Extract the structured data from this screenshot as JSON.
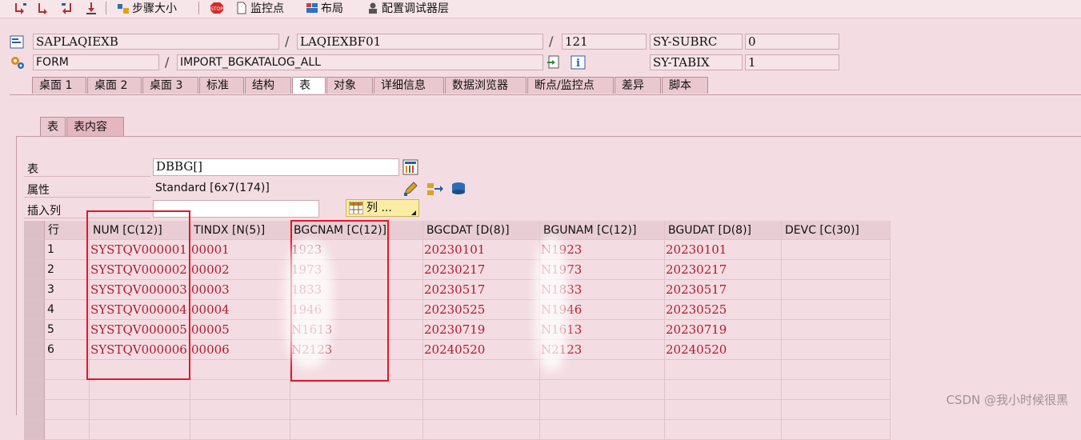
{
  "toolbar": {
    "step_size": "步骤大小",
    "watchpoint": "监控点",
    "layout": "布局",
    "config_layer": "配置调试器层"
  },
  "header": {
    "program": "SAPLAQIEXB",
    "include": "LAQIEXBF01",
    "line": "121",
    "sy_subrc_label": "SY-SUBRC",
    "sy_subrc_value": "0",
    "event_type": "FORM",
    "event_name": "IMPORT_BGKATALOG_ALL",
    "sy_tabix_label": "SY-TABIX",
    "sy_tabix_value": "1"
  },
  "tabs": [
    "桌面 1",
    "桌面 2",
    "桌面 3",
    "标准",
    "结构",
    "表",
    "对象",
    "详细信息",
    "数据浏览器",
    "断点/监控点",
    "差异",
    "脚本"
  ],
  "subtabs": [
    "表",
    "表内容"
  ],
  "table_panel": {
    "table_label": "表",
    "table_value": "DBBG[]",
    "attr_label": "属性",
    "attr_value": "Standard [6x7(174)]",
    "insert_col_label": "插入列",
    "col_button": "列 ..."
  },
  "grid": {
    "row_header": "行",
    "columns": [
      "NUM [C(12)]",
      "TINDX [N(5)]",
      "BGCNAM [C(12)]",
      "BGCDAT [D(8)]",
      "BGUNAM [C(12)]",
      "BGUDAT [D(8)]",
      "DEVC [C(30)]"
    ],
    "rows": [
      [
        "1",
        "SYSTQV000001",
        "00001",
        "1923",
        "20230101",
        "N1923",
        "20230101",
        ""
      ],
      [
        "2",
        "SYSTQV000002",
        "00002",
        "1973",
        "20230217",
        "N1973",
        "20230217",
        ""
      ],
      [
        "3",
        "SYSTQV000003",
        "00003",
        "1833",
        "20230517",
        "N1833",
        "20230517",
        ""
      ],
      [
        "4",
        "SYSTQV000004",
        "00004",
        "1946",
        "20230525",
        "N1946",
        "20230525",
        ""
      ],
      [
        "5",
        "SYSTQV000005",
        "00005",
        "N1613",
        "20230719",
        "N1613",
        "20230719",
        ""
      ],
      [
        "6",
        "SYSTQV000006",
        "00006",
        "N2123",
        "20240520",
        "N2123",
        "20240520",
        ""
      ]
    ]
  },
  "watermark": "CSDN @我小时候很黑",
  "colors": {
    "data_text": "#b11932",
    "highlight_box": "#e0182b",
    "background": "#f4dde2"
  }
}
